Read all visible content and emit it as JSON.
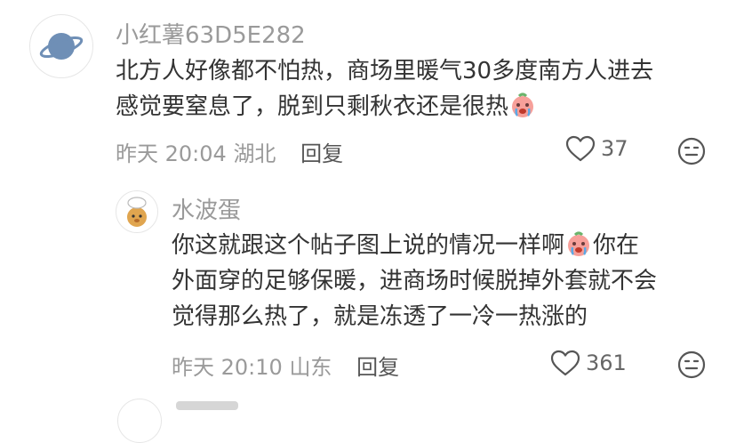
{
  "comments": [
    {
      "author": "小红薯63D5E282",
      "avatar_icon": "planet-icon",
      "lines": [
        "北方人好像都不怕热，商场里暖气30多度南方人进去",
        "感觉要窒息了，脱到只剩秋衣还是很热"
      ],
      "trailing_emoji": "crying-face-emoji",
      "time": "昨天 20:04",
      "location": "湖北",
      "reply_label": "回复",
      "likes": "37"
    },
    {
      "author": "水波蛋",
      "avatar_icon": "chef-dog-icon",
      "lines": [
        "你这就跟这个帖子图上说的情况一样啊",
        "你在",
        "外面穿的足够保暖，进商场时候脱掉外套就不会",
        "觉得那么热了，就是冻透了一冷一热涨的"
      ],
      "time": "昨天 20:10",
      "location": "山东",
      "reply_label": "回复",
      "likes": "361"
    }
  ],
  "colors": {
    "meta": "#9a9a9a",
    "text": "#333333",
    "emoji_red": "#f36b6b"
  }
}
